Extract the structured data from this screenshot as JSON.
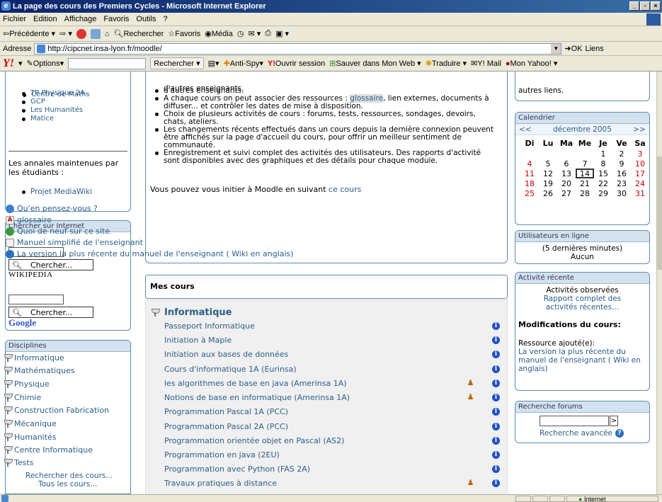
{
  "window": {
    "title": "La page des cours des Premiers Cycles - Microsoft Internet Explorer",
    "min": "_",
    "max": "b",
    "close": "X"
  },
  "menu": [
    "Fichier",
    "Edition",
    "Affichage",
    "Favoris",
    "Outils",
    "?"
  ],
  "toolbar": {
    "back": "Précédente",
    "search": "Rechercher",
    "favorites": "Favoris",
    "media": "Média"
  },
  "address": {
    "label": "Adresse",
    "url": "http://cipcnet.insa-lyon.fr/moodle/",
    "go": "OK",
    "links": "Liens"
  },
  "yahoo": {
    "logo": "Y!",
    "options": "Options",
    "search_btn": "Rechercher",
    "antispy": "Anti-Spy",
    "session": "Ouvrir session",
    "save": "Sauver dans Mon Web",
    "translate": "Traduire",
    "mail": "Y! Mail",
    "myyahoo": "Mon Yahoo!"
  },
  "left": {
    "links": [
      "Centre de Maths",
      "TP Physique 2A",
      "GCP",
      "Les Humanités",
      "Matice"
    ],
    "annales_text": "Les annales maintenues par les étudiants :",
    "annales_link": "Projet MediaWiki",
    "search_title": "Chercher sur Internet",
    "search_btn": "Chercher...",
    "wiki_logo": "WIKIPEDIA",
    "google_logo": "Google",
    "disc_title": "Disciplines",
    "disciplines": [
      "Informatique",
      "Mathématiques",
      "Physique",
      "Chimie",
      "Construction Fabrication",
      "Mécanique",
      "Humanités",
      "Centre Informatique",
      "Tests"
    ],
    "search_courses": "Rechercher des cours...",
    "all_courses": "Tous les cours..."
  },
  "center": {
    "bullets": [
      {
        "a": "d'autres enseignants."
      },
      {
        "a": "A chaque cours on peut associer des ressources : ",
        "hl": "glossaire",
        "b": ", lien externes, documents à",
        "c": "diffuser... et contrôler les dates de mise à disposition."
      },
      {
        "a": "Choix de plusieurs activités de cours : forums, tests, ressources, sondages, devoirs,",
        "c": "chats, ateliers."
      },
      {
        "a": "Les changements récents effectués dans un cours depuis la dernière connexion peuvent",
        "c": "être affichés sur la page d'accueil du cours, pour offrir un meilleur sentiment de",
        "d": "communauté."
      },
      {
        "a": "Enregistrement et suivi complet des activités des utilisateurs. Des rapports d'activité",
        "c": "sont disponibles avec des graphiques et des détails pour chaque module."
      }
    ],
    "init_text": "Vous pouvez vous initier à Moodle en suivant ",
    "init_link": "ce cours",
    "activities": [
      "Qu'en pensez-vous ?",
      "glossaire",
      "Quoi de neuf sur ce site",
      "Manuel simplifié de l'enseignant",
      "La version la plus récente du manuel de l'enseignant ( Wiki en anglais)"
    ],
    "mycourses": "Mes cours",
    "category": "Informatique",
    "courses": [
      "Passeport Informatique",
      "Initiation à Maple",
      "Initiation aux bases de données",
      "Cours d'informatique 1A (Eurinsa)",
      "les algorithmes de base en java (Amerinsa 1A)",
      "Notions de base en informatique (Amerinsa 1A)",
      "Programmation Pascal 1A (PCC)",
      "Programmation Pascal 2A (PCC)",
      "Programmation orientée objet en Pascal (AS2)",
      "Programmation en java (2EU)",
      "Programmation avec Python (FAS 2A)",
      "Travaux pratiques à distance"
    ]
  },
  "right": {
    "top_text": "autres liens.",
    "cal_title": "Calendrier",
    "cal_prev": "<<",
    "cal_month": "décembre 2005",
    "cal_next": ">>",
    "days": [
      "Di",
      "Lu",
      "Ma",
      "Me",
      "Je",
      "Ve",
      "Sa"
    ],
    "weeks": [
      [
        "",
        "",
        "",
        "",
        "1",
        "2",
        "3"
      ],
      [
        "4",
        "5",
        "6",
        "7",
        "8",
        "9",
        "10"
      ],
      [
        "11",
        "12",
        "13",
        "14",
        "15",
        "16",
        "17"
      ],
      [
        "18",
        "19",
        "20",
        "21",
        "22",
        "23",
        "24"
      ],
      [
        "25",
        "26",
        "27",
        "28",
        "29",
        "30",
        "31"
      ]
    ],
    "online_title": "Utilisateurs en ligne",
    "online_range": "(5 dernières minutes)",
    "online_none": "Aucun",
    "recent_title": "Activité récente",
    "recent_observed": "Activités observées",
    "recent_report": "Rapport complet des activités récentes...",
    "modif_title": "Modifications du cours:",
    "resource_added": "Ressource ajouté(e):",
    "resource_link": "La version la plus récente du manuel de l'enseignant ( Wiki en anglais)",
    "forum_title": "Recherche forums",
    "forum_go": ">",
    "forum_adv": "Recherche avancée"
  },
  "status": {
    "zone": "Internet"
  }
}
